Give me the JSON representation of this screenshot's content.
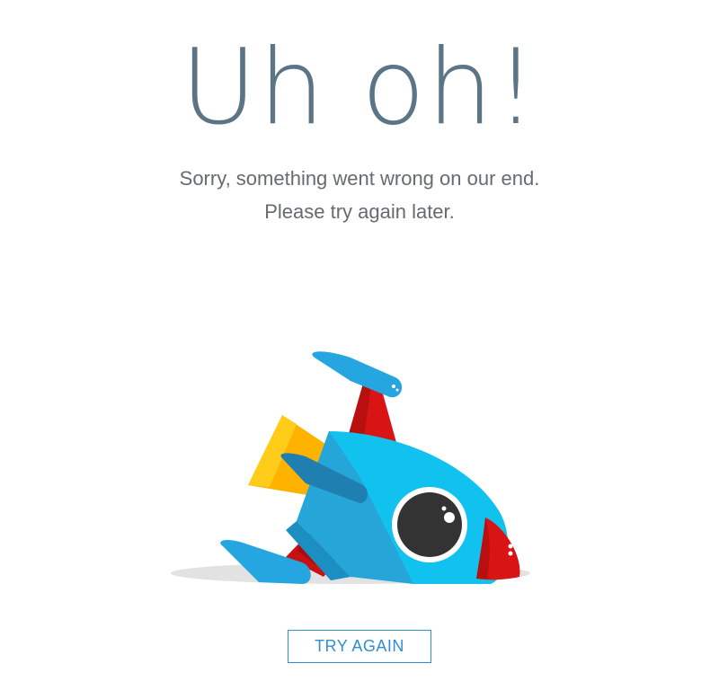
{
  "error_page": {
    "headline": "Uh oh!",
    "message_line1": "Sorry, something went wrong on our end.",
    "message_line2": "Please try again later.",
    "illustration_label": "crashed-rocket",
    "retry_button_label": "TRY AGAIN"
  },
  "colors": {
    "headline": "#5b7486",
    "message": "#666b70",
    "accent": "#2f8fd0",
    "rocket_body": "#26b0e8",
    "rocket_fin": "#d81414",
    "rocket_flame": "#ffb300",
    "shadow": "#e0e0e0"
  }
}
